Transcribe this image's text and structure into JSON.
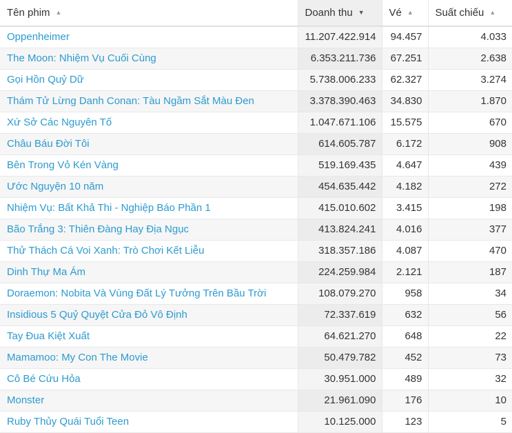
{
  "columns": {
    "name": "Tên phim",
    "revenue": "Doanh thu",
    "tickets": "Vé",
    "showings": "Suất chiếu"
  },
  "sort": {
    "asc_arrow": "▲",
    "desc_arrow": "▼"
  },
  "rows": [
    {
      "name": "Oppenheimer",
      "revenue": "11.207.422.914",
      "tickets": "94.457",
      "showings": "4.033"
    },
    {
      "name": "The Moon: Nhiệm Vụ Cuối Cùng",
      "revenue": "6.353.211.736",
      "tickets": "67.251",
      "showings": "2.638"
    },
    {
      "name": "Gọi Hồn Quỷ Dữ",
      "revenue": "5.738.006.233",
      "tickets": "62.327",
      "showings": "3.274"
    },
    {
      "name": "Thám Tử Lừng Danh Conan: Tàu Ngầm Sắt Màu Đen",
      "revenue": "3.378.390.463",
      "tickets": "34.830",
      "showings": "1.870"
    },
    {
      "name": "Xứ Sở Các Nguyên Tố",
      "revenue": "1.047.671.106",
      "tickets": "15.575",
      "showings": "670"
    },
    {
      "name": "Châu Báu Đời Tôi",
      "revenue": "614.605.787",
      "tickets": "6.172",
      "showings": "908"
    },
    {
      "name": "Bên Trong Vỏ Kén Vàng",
      "revenue": "519.169.435",
      "tickets": "4.647",
      "showings": "439"
    },
    {
      "name": "Ước Nguyện 10 năm",
      "revenue": "454.635.442",
      "tickets": "4.182",
      "showings": "272"
    },
    {
      "name": "Nhiệm Vụ: Bất Khả Thi - Nghiệp Báo Phần 1",
      "revenue": "415.010.602",
      "tickets": "3.415",
      "showings": "198"
    },
    {
      "name": "Bão Trắng 3: Thiên Đàng Hay Địa Ngục",
      "revenue": "413.824.241",
      "tickets": "4.016",
      "showings": "377"
    },
    {
      "name": "Thử Thách Cá Voi Xanh: Trò Chơi Kết Liễu",
      "revenue": "318.357.186",
      "tickets": "4.087",
      "showings": "470"
    },
    {
      "name": "Dinh Thự Ma Ám",
      "revenue": "224.259.984",
      "tickets": "2.121",
      "showings": "187"
    },
    {
      "name": "Doraemon: Nobita Và Vùng Đất Lý Tưởng Trên Bầu Trời",
      "revenue": "108.079.270",
      "tickets": "958",
      "showings": "34"
    },
    {
      "name": "Insidious 5 Quỷ Quyệt Cửa Đỏ Vô Định",
      "revenue": "72.337.619",
      "tickets": "632",
      "showings": "56"
    },
    {
      "name": "Tay Đua Kiệt Xuất",
      "revenue": "64.621.270",
      "tickets": "648",
      "showings": "22"
    },
    {
      "name": "Mamamoo: My Con The Movie",
      "revenue": "50.479.782",
      "tickets": "452",
      "showings": "73"
    },
    {
      "name": "Cô Bé Cứu Hỏa",
      "revenue": "30.951.000",
      "tickets": "489",
      "showings": "32"
    },
    {
      "name": "Monster",
      "revenue": "21.961.090",
      "tickets": "176",
      "showings": "10"
    },
    {
      "name": "Ruby Thủy Quái Tuổi Teen",
      "revenue": "10.125.000",
      "tickets": "123",
      "showings": "5"
    }
  ]
}
